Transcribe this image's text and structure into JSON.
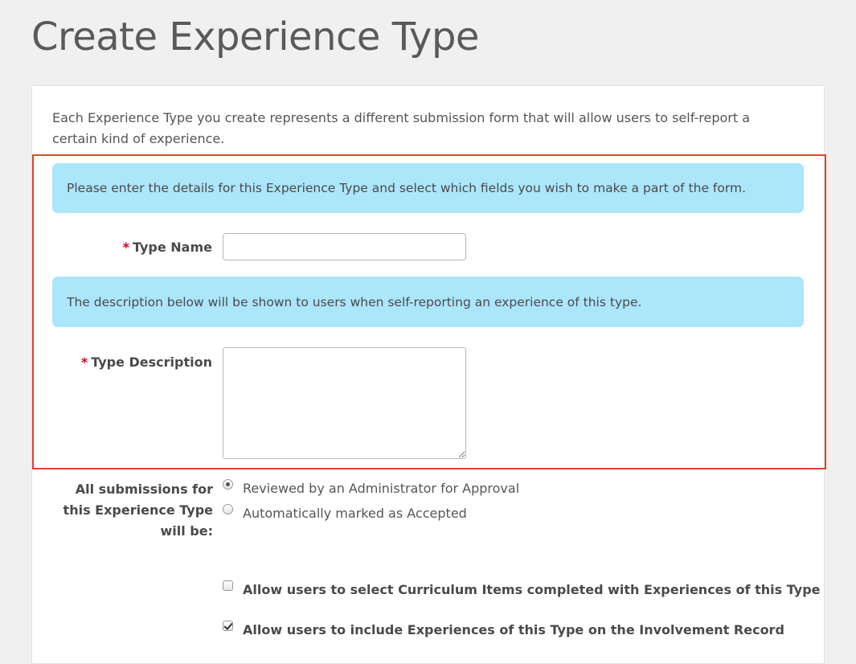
{
  "page": {
    "title": "Create Experience Type"
  },
  "intro": {
    "text": "Each Experience Type you create represents a different submission form that will allow users to self-report a certain kind of experience."
  },
  "info": {
    "details": "Please enter the details for this Experience Type and select which fields you wish to make a part of the form.",
    "description_note": "The description below will be shown to users when self-reporting an experience of this type."
  },
  "form": {
    "required_marker": "*",
    "type_name": {
      "label": "Type Name",
      "value": ""
    },
    "type_description": {
      "label": "Type Description",
      "value": ""
    },
    "submissions": {
      "label_lines": [
        "All submissions for",
        "this Experience Type",
        "will be:"
      ],
      "options": [
        {
          "label": "Reviewed by an Administrator for Approval",
          "selected": true
        },
        {
          "label": "Automatically marked as Accepted",
          "selected": false
        }
      ]
    },
    "checkboxes": [
      {
        "label": "Allow users to select Curriculum Items completed with Experiences of this Type",
        "checked": false
      },
      {
        "label": "Allow users to include Experiences of this Type on the Involvement Record",
        "checked": true
      }
    ]
  },
  "colors": {
    "background": "#f0f0f0",
    "info_background": "#abe6fb",
    "highlight_border": "#e8412c",
    "required": "#d0021b"
  }
}
